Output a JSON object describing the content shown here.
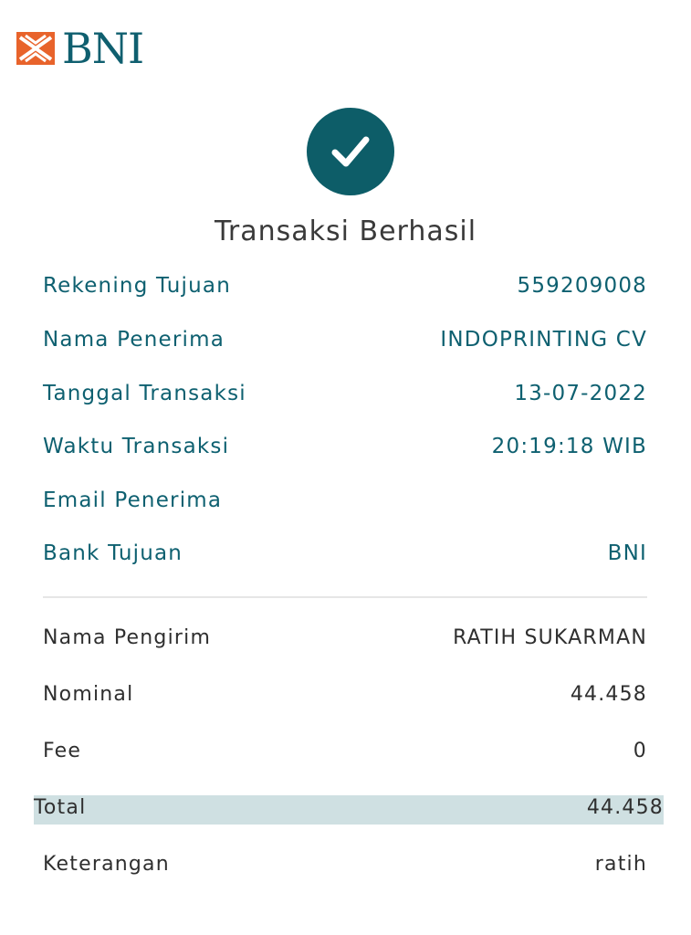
{
  "brand": {
    "logo_text": "BNI",
    "primary_color": "#0d5d68",
    "accent_color": "#e8632b"
  },
  "status": {
    "icon": "check-icon",
    "title": "Transaksi Berhasil"
  },
  "details": [
    {
      "label": "Rekening Tujuan",
      "value": "559209008"
    },
    {
      "label": "Nama Penerima",
      "value": "INDOPRINTING CV"
    },
    {
      "label": "Tanggal Transaksi",
      "value": "13-07-2022"
    },
    {
      "label": "Waktu Transaksi",
      "value": "20:19:18 WIB"
    },
    {
      "label": "Email Penerima",
      "value": ""
    },
    {
      "label": "Bank Tujuan",
      "value": "BNI"
    }
  ],
  "summary": [
    {
      "label": "Nama Pengirim",
      "value": "RATIH SUKARMAN"
    },
    {
      "label": "Nominal",
      "value": "44.458"
    },
    {
      "label": "Fee",
      "value": "0"
    }
  ],
  "total": {
    "label": "Total",
    "value": "44.458"
  },
  "note": {
    "label": "Keterangan",
    "value": "ratih"
  }
}
